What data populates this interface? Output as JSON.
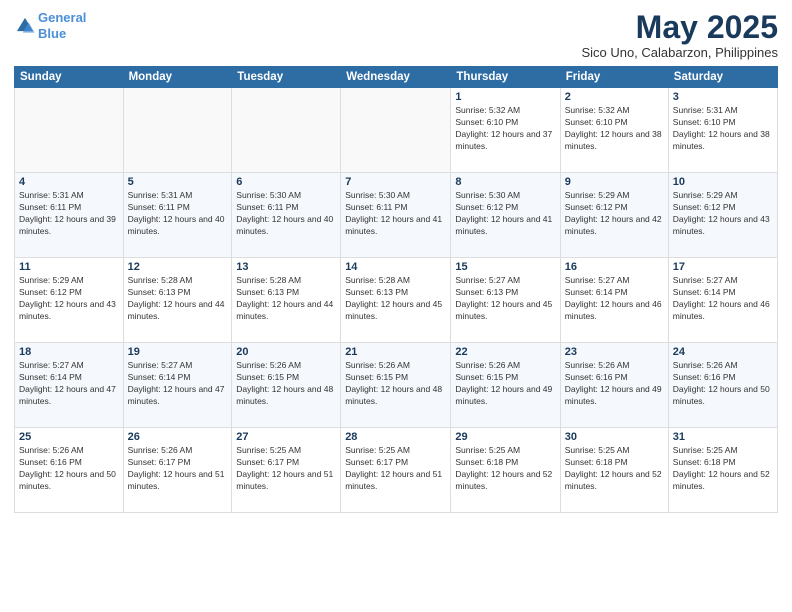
{
  "logo": {
    "line1": "General",
    "line2": "Blue"
  },
  "title": "May 2025",
  "subtitle": "Sico Uno, Calabarzon, Philippines",
  "days_header": [
    "Sunday",
    "Monday",
    "Tuesday",
    "Wednesday",
    "Thursday",
    "Friday",
    "Saturday"
  ],
  "weeks": [
    [
      {
        "day": "",
        "sunrise": "",
        "sunset": "",
        "daylight": ""
      },
      {
        "day": "",
        "sunrise": "",
        "sunset": "",
        "daylight": ""
      },
      {
        "day": "",
        "sunrise": "",
        "sunset": "",
        "daylight": ""
      },
      {
        "day": "",
        "sunrise": "",
        "sunset": "",
        "daylight": ""
      },
      {
        "day": "1",
        "sunrise": "Sunrise: 5:32 AM",
        "sunset": "Sunset: 6:10 PM",
        "daylight": "Daylight: 12 hours and 37 minutes."
      },
      {
        "day": "2",
        "sunrise": "Sunrise: 5:32 AM",
        "sunset": "Sunset: 6:10 PM",
        "daylight": "Daylight: 12 hours and 38 minutes."
      },
      {
        "day": "3",
        "sunrise": "Sunrise: 5:31 AM",
        "sunset": "Sunset: 6:10 PM",
        "daylight": "Daylight: 12 hours and 38 minutes."
      }
    ],
    [
      {
        "day": "4",
        "sunrise": "Sunrise: 5:31 AM",
        "sunset": "Sunset: 6:11 PM",
        "daylight": "Daylight: 12 hours and 39 minutes."
      },
      {
        "day": "5",
        "sunrise": "Sunrise: 5:31 AM",
        "sunset": "Sunset: 6:11 PM",
        "daylight": "Daylight: 12 hours and 40 minutes."
      },
      {
        "day": "6",
        "sunrise": "Sunrise: 5:30 AM",
        "sunset": "Sunset: 6:11 PM",
        "daylight": "Daylight: 12 hours and 40 minutes."
      },
      {
        "day": "7",
        "sunrise": "Sunrise: 5:30 AM",
        "sunset": "Sunset: 6:11 PM",
        "daylight": "Daylight: 12 hours and 41 minutes."
      },
      {
        "day": "8",
        "sunrise": "Sunrise: 5:30 AM",
        "sunset": "Sunset: 6:12 PM",
        "daylight": "Daylight: 12 hours and 41 minutes."
      },
      {
        "day": "9",
        "sunrise": "Sunrise: 5:29 AM",
        "sunset": "Sunset: 6:12 PM",
        "daylight": "Daylight: 12 hours and 42 minutes."
      },
      {
        "day": "10",
        "sunrise": "Sunrise: 5:29 AM",
        "sunset": "Sunset: 6:12 PM",
        "daylight": "Daylight: 12 hours and 43 minutes."
      }
    ],
    [
      {
        "day": "11",
        "sunrise": "Sunrise: 5:29 AM",
        "sunset": "Sunset: 6:12 PM",
        "daylight": "Daylight: 12 hours and 43 minutes."
      },
      {
        "day": "12",
        "sunrise": "Sunrise: 5:28 AM",
        "sunset": "Sunset: 6:13 PM",
        "daylight": "Daylight: 12 hours and 44 minutes."
      },
      {
        "day": "13",
        "sunrise": "Sunrise: 5:28 AM",
        "sunset": "Sunset: 6:13 PM",
        "daylight": "Daylight: 12 hours and 44 minutes."
      },
      {
        "day": "14",
        "sunrise": "Sunrise: 5:28 AM",
        "sunset": "Sunset: 6:13 PM",
        "daylight": "Daylight: 12 hours and 45 minutes."
      },
      {
        "day": "15",
        "sunrise": "Sunrise: 5:27 AM",
        "sunset": "Sunset: 6:13 PM",
        "daylight": "Daylight: 12 hours and 45 minutes."
      },
      {
        "day": "16",
        "sunrise": "Sunrise: 5:27 AM",
        "sunset": "Sunset: 6:14 PM",
        "daylight": "Daylight: 12 hours and 46 minutes."
      },
      {
        "day": "17",
        "sunrise": "Sunrise: 5:27 AM",
        "sunset": "Sunset: 6:14 PM",
        "daylight": "Daylight: 12 hours and 46 minutes."
      }
    ],
    [
      {
        "day": "18",
        "sunrise": "Sunrise: 5:27 AM",
        "sunset": "Sunset: 6:14 PM",
        "daylight": "Daylight: 12 hours and 47 minutes."
      },
      {
        "day": "19",
        "sunrise": "Sunrise: 5:27 AM",
        "sunset": "Sunset: 6:14 PM",
        "daylight": "Daylight: 12 hours and 47 minutes."
      },
      {
        "day": "20",
        "sunrise": "Sunrise: 5:26 AM",
        "sunset": "Sunset: 6:15 PM",
        "daylight": "Daylight: 12 hours and 48 minutes."
      },
      {
        "day": "21",
        "sunrise": "Sunrise: 5:26 AM",
        "sunset": "Sunset: 6:15 PM",
        "daylight": "Daylight: 12 hours and 48 minutes."
      },
      {
        "day": "22",
        "sunrise": "Sunrise: 5:26 AM",
        "sunset": "Sunset: 6:15 PM",
        "daylight": "Daylight: 12 hours and 49 minutes."
      },
      {
        "day": "23",
        "sunrise": "Sunrise: 5:26 AM",
        "sunset": "Sunset: 6:16 PM",
        "daylight": "Daylight: 12 hours and 49 minutes."
      },
      {
        "day": "24",
        "sunrise": "Sunrise: 5:26 AM",
        "sunset": "Sunset: 6:16 PM",
        "daylight": "Daylight: 12 hours and 50 minutes."
      }
    ],
    [
      {
        "day": "25",
        "sunrise": "Sunrise: 5:26 AM",
        "sunset": "Sunset: 6:16 PM",
        "daylight": "Daylight: 12 hours and 50 minutes."
      },
      {
        "day": "26",
        "sunrise": "Sunrise: 5:26 AM",
        "sunset": "Sunset: 6:17 PM",
        "daylight": "Daylight: 12 hours and 51 minutes."
      },
      {
        "day": "27",
        "sunrise": "Sunrise: 5:25 AM",
        "sunset": "Sunset: 6:17 PM",
        "daylight": "Daylight: 12 hours and 51 minutes."
      },
      {
        "day": "28",
        "sunrise": "Sunrise: 5:25 AM",
        "sunset": "Sunset: 6:17 PM",
        "daylight": "Daylight: 12 hours and 51 minutes."
      },
      {
        "day": "29",
        "sunrise": "Sunrise: 5:25 AM",
        "sunset": "Sunset: 6:18 PM",
        "daylight": "Daylight: 12 hours and 52 minutes."
      },
      {
        "day": "30",
        "sunrise": "Sunrise: 5:25 AM",
        "sunset": "Sunset: 6:18 PM",
        "daylight": "Daylight: 12 hours and 52 minutes."
      },
      {
        "day": "31",
        "sunrise": "Sunrise: 5:25 AM",
        "sunset": "Sunset: 6:18 PM",
        "daylight": "Daylight: 12 hours and 52 minutes."
      }
    ]
  ]
}
